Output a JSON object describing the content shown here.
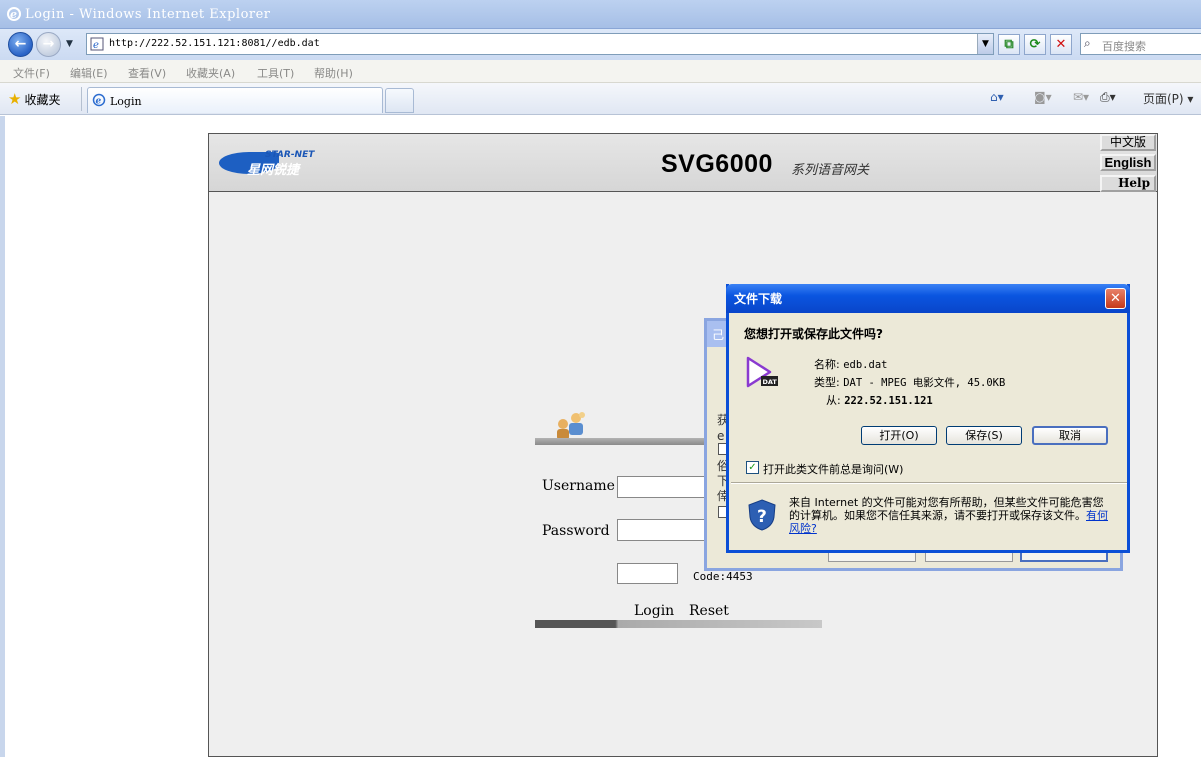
{
  "window": {
    "title": "Login - Windows Internet Explorer"
  },
  "address_bar": {
    "url": "http://222.52.151.121:8081//edb.dat",
    "search_placeholder": "百度搜索"
  },
  "menu": {
    "items": [
      "文件(F)",
      "编辑(E)",
      "查看(V)",
      "收藏夹(A)",
      "工具(T)",
      "帮助(H)"
    ]
  },
  "tabs": {
    "favorites_label": "收藏夹",
    "active_tab_label": "Login",
    "page_menu_label": "页面(P)"
  },
  "router_page": {
    "brand_en": "STAR-NET",
    "brand_cn": "星网锐捷",
    "model": "SVG6000",
    "model_subtitle": "系列语音网关",
    "lang_cn": "中文版",
    "lang_en": "English",
    "help": "Help",
    "username_label": "Username",
    "password_label": "Password",
    "code_text": "Code:4453",
    "login_label": "Login",
    "reset_label": "Reset"
  },
  "back_dialog": {
    "partial_title": "己",
    "partial_lines": [
      "获",
      "e",
      "俗",
      "下",
      "倖"
    ]
  },
  "download_dialog": {
    "title": "文件下载",
    "question": "您想打开或保存此文件吗?",
    "name_label": "名称:",
    "name_value": "edb.dat",
    "type_label": "类型:",
    "type_value": "DAT - MPEG 电影文件, 45.0KB",
    "from_label": "从:",
    "from_value": "222.52.151.121",
    "open_button": "打开(O)",
    "save_button": "保存(S)",
    "cancel_button": "取消",
    "checkbox_label": "打开此类文件前总是询问(W)",
    "checkbox_checked": true,
    "warning_text": "来自 Internet 的文件可能对您有所帮助，但某些文件可能危害您的计算机。如果您不信任其来源，请不要打开或保存该文件。",
    "risk_link": "有何风险?",
    "icon_badge": "DAT"
  }
}
